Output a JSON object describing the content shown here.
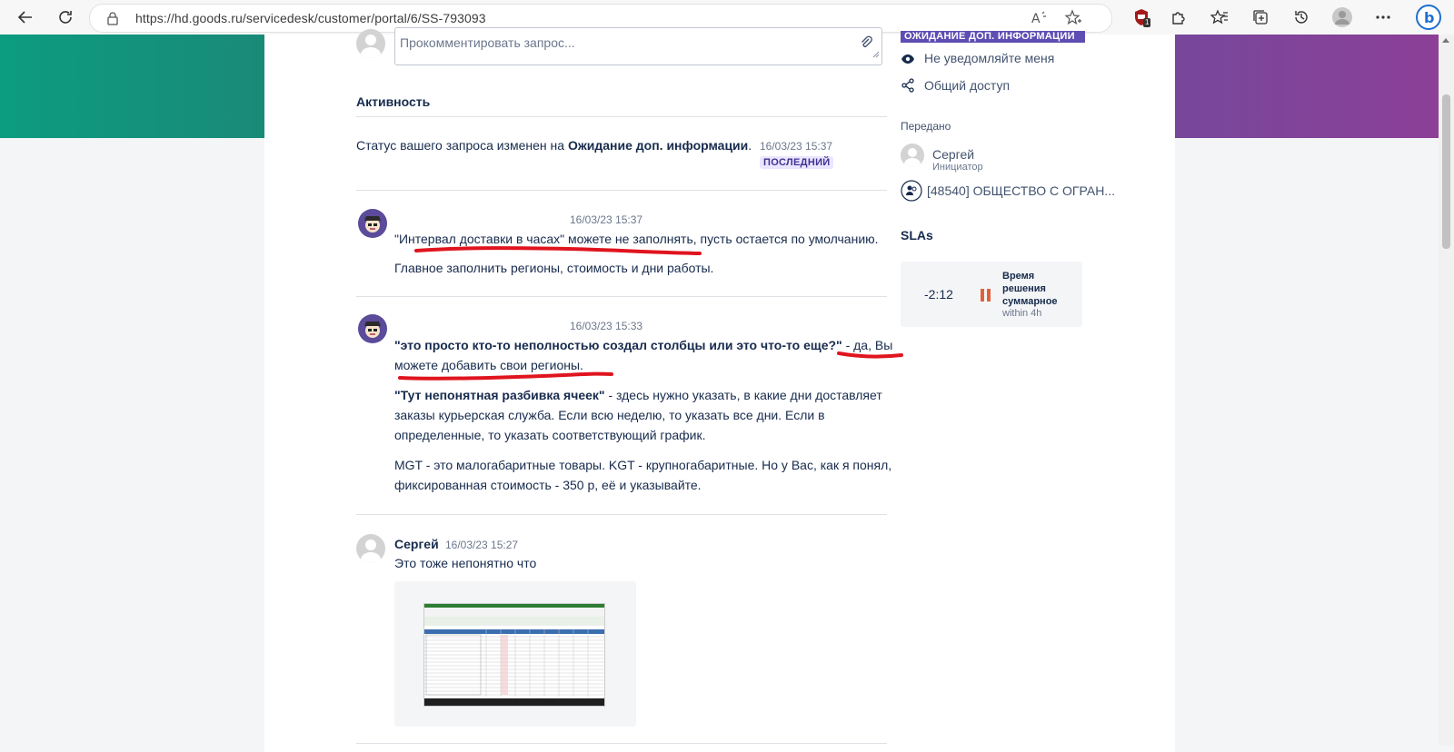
{
  "browser": {
    "url": "https://hd.goods.ru/servicedesk/customer/portal/6/SS-793093",
    "extension_badge": "1",
    "icons": [
      "back-icon",
      "refresh-icon",
      "lock-icon",
      "read-aloud-icon",
      "add-favorite-icon",
      "extension-shield-icon",
      "extensions-puzzle-icon",
      "favorites-icon",
      "collections-icon",
      "history-icon",
      "profile-icon",
      "more-icon",
      "bing-icon"
    ]
  },
  "comment": {
    "placeholder": "Прокомментировать запрос..."
  },
  "activity": {
    "heading": "Активность",
    "status_change": {
      "prefix": "Статус вашего запроса изменен на ",
      "status": "Ожидание доп. информации",
      "suffix": ".",
      "time": "16/03/23 15:37",
      "badge": "ПОСЛЕДНИЙ"
    },
    "items": [
      {
        "time": "16/03/23 15:37",
        "line1": "\"Интервал доставки в часах\" можете не заполнять, пусть остается по умолчанию.",
        "line2": "Главное заполнить регионы, стоимость и дни работы."
      },
      {
        "time": "16/03/23 15:33",
        "bold1": "\"это просто кто-то неполностью создал столбцы или это что-то еще?\"",
        "rest1": " - да, Вы",
        "line1b": "можете добавить свои регионы.",
        "bold2": "\"Тут непонятная разбивка ячеек\"",
        "rest2": " - здесь нужно указать, в какие дни доставляет",
        "line2b": "заказы курьерская служба. Если всю неделю, то указать все дни. Если в",
        "line2c": "определенные, то указать соответствующий график.",
        "line3a": "MGT - это малогабаритные товары. KGT - крупногабаритные. Но у Вас, как я понял,",
        "line3b": "фиксированная стоимость - 350 р, её и указывайте."
      },
      {
        "author": "Сергей",
        "time": "16/03/23 15:27",
        "text": "Это тоже непонятно что"
      }
    ]
  },
  "sidebar": {
    "status": "ОЖИДАНИЕ ДОП. ИНФОРМАЦИИ",
    "notify": "Не уведомляйте меня",
    "share": "Общий доступ",
    "shared_with_label": "Передано",
    "initiator_name": "Сергей",
    "initiator_role": "Инициатор",
    "organization": "[48540] ОБЩЕСТВО С ОГРАН...",
    "slas_heading": "SLAs",
    "sla": {
      "time": "-2:12",
      "title": "Время решения суммарное",
      "goal": "within 4h"
    }
  },
  "colors": {
    "accent": "#5e4db2",
    "annotation": "#e0141e",
    "sla_pause": "#e2603a"
  }
}
